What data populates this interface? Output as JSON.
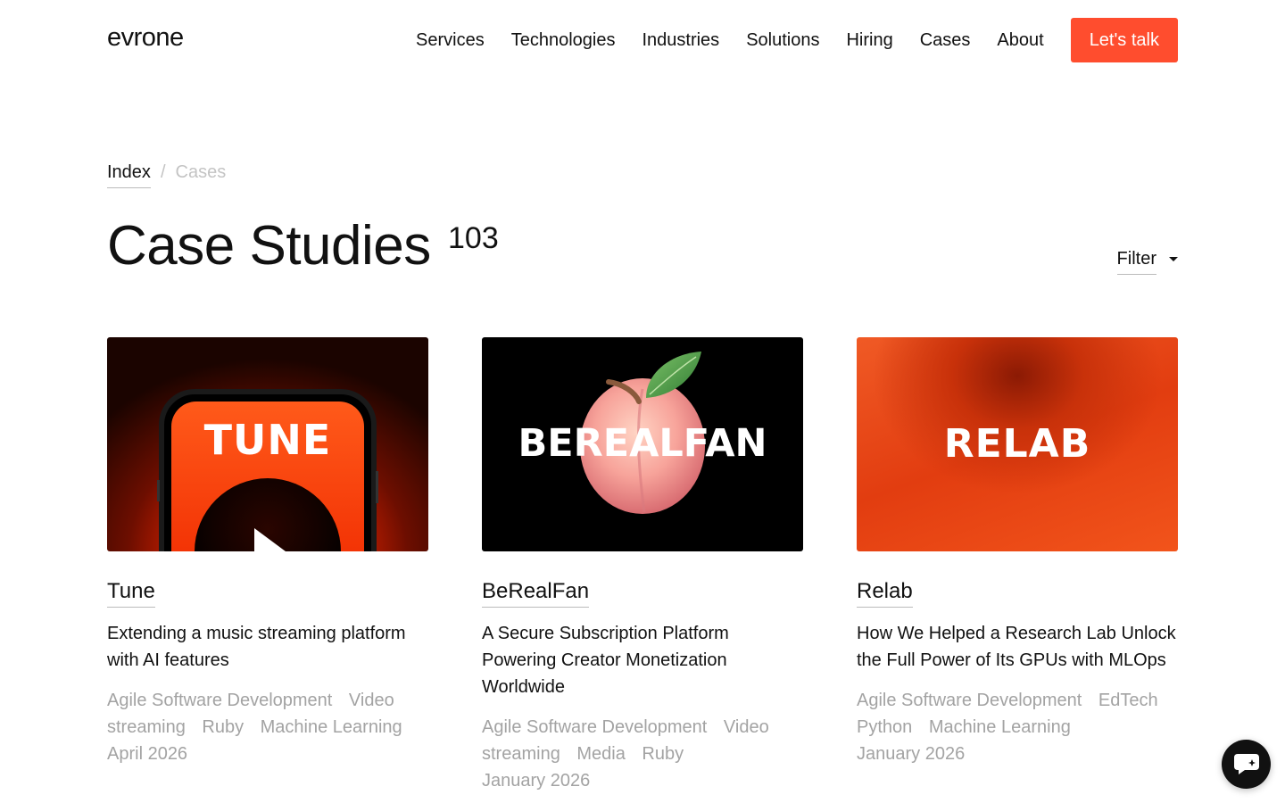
{
  "header": {
    "logo": "evrone",
    "nav": [
      "Services",
      "Technologies",
      "Industries",
      "Solutions",
      "Hiring",
      "Cases",
      "About"
    ],
    "cta": "Let's talk"
  },
  "breadcrumb": {
    "index": "Index",
    "separator": "/",
    "current": "Cases"
  },
  "page": {
    "title": "Case Studies",
    "count": "103",
    "filter": "Filter"
  },
  "cards": [
    {
      "image_text": "TUNE",
      "name": "Tune",
      "description": "Extending a music streaming platform with AI features",
      "tags": [
        "Agile Software Development",
        "Video streaming",
        "Ruby",
        "Machine Learning"
      ],
      "date": "April 2026"
    },
    {
      "image_text": "BEREALFAN",
      "name": "BeRealFan",
      "description": "A Secure Subscription Platform Powering Creator Monetization Worldwide",
      "tags": [
        "Agile Software Development",
        "Video streaming",
        "Media",
        "Ruby"
      ],
      "date": "January 2026"
    },
    {
      "image_text": "RELAB",
      "name": "Relab",
      "description": "How We Helped a Research Lab Unlock the Full Power of Its GPUs with MLOps",
      "tags": [
        "Agile Software Development",
        "EdTech",
        "Python",
        "Machine Learning"
      ],
      "date": "January 2026"
    }
  ],
  "colors": {
    "accent": "#ff4d2e",
    "muted": "#a3a3a3",
    "text": "#111111"
  }
}
